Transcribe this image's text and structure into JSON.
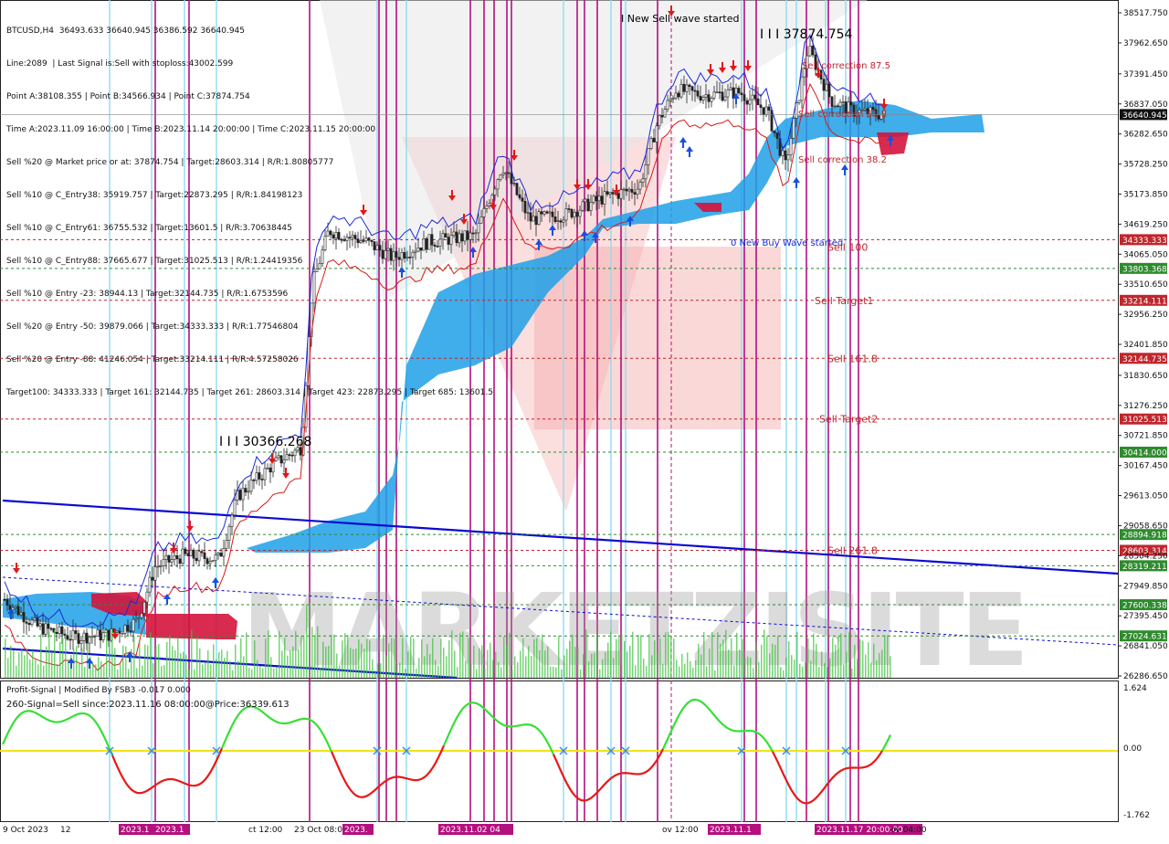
{
  "header": {
    "lines": [
      "BTCUSD,H4  36493.633 36640.945 36386.592 36640.945",
      "Line:2089  | Last Signal is:Sell with stoploss:43002.599",
      "Point A:38108.355 | Point B:34566.934 | Point C:37874.754",
      "Time A:2023.11.09 16:00:00 | Time B:2023.11.14 20:00:00 | Time C:2023.11.15 20:00:00",
      "Sell %20 @ Market price or at: 37874.754 | Target:28603.314 | R/R:1.80805777",
      "Sell %10 @ C_Entry38: 35919.757 | Target:22873.295 | R/R:1.84198123",
      "Sell %10 @ C_Entry61: 36755.532 | Target:13601.5 | R/R:3.70638445",
      "Sell %10 @ C_Entry88: 37665.677 | Target:31025.513 | R/R:1.24419356",
      "Sell %10 @ Entry -23: 38944.13 | Target:32144.735 | R/R:1.6753596",
      "Sell %20 @ Entry -50: 39879.066 | Target:34333.333 | R/R:1.77546804",
      "Sell %20 @ Entry -88: 41246.054 | Target:33214.111 | R/R:4.57258026",
      "Target100: 34333.333 | Target 161: 32144.735 | Target 261: 28603.314 | Target 423: 22873.295 | Target 685: 13601.5"
    ]
  },
  "price_axis": {
    "ticks": [
      "38517.750",
      "37962.650",
      "37391.450",
      "36837.050",
      "36282.650",
      "35728.250",
      "35173.850",
      "34619.250",
      "34065.050",
      "33510.650",
      "32956.250",
      "32401.850",
      "31830.650",
      "31276.250",
      "30721.850",
      "30167.450",
      "29613.050",
      "29058.650",
      "28504.250",
      "27949.850",
      "27395.450",
      "26841.050",
      "26286.650"
    ],
    "current": "36640.945"
  },
  "levels": [
    {
      "value": "34333.333",
      "color": "#c0262c",
      "label": "Sell 100",
      "label_color": "#c0262c"
    },
    {
      "value": "33803.368",
      "color": "#2e8b2e",
      "label": "",
      "label_color": ""
    },
    {
      "value": "33214.111",
      "color": "#c0262c",
      "label": "Sell Target1",
      "label_color": "#c0262c"
    },
    {
      "value": "32144.735",
      "color": "#c0262c",
      "label": "Sell 161.8",
      "label_color": "#c0262c"
    },
    {
      "value": "31025.513",
      "color": "#c0262c",
      "label": "Sell Target2",
      "label_color": "#c0262c"
    },
    {
      "value": "30414.000",
      "color": "#2e8b2e",
      "label": "",
      "label_color": ""
    },
    {
      "value": "28894.918",
      "color": "#2e8b2e",
      "label": "",
      "label_color": ""
    },
    {
      "value": "28603.314",
      "color": "#c0262c",
      "label": "Sell 261.8",
      "label_color": "#c0262c"
    },
    {
      "value": "28319.211",
      "color": "#2e8b2e",
      "label": "",
      "label_color": ""
    },
    {
      "value": "27600.338",
      "color": "#2e8b2e",
      "label": "",
      "label_color": ""
    },
    {
      "value": "27024.631",
      "color": "#2e8b2e",
      "label": "",
      "label_color": ""
    }
  ],
  "annotations": {
    "new_sell": "New Sell wave started",
    "point_c": "I I I 37874.754",
    "point_prev": "I I I 30366.268",
    "new_buy": "0 New Buy Wave started",
    "corr_875": "Sell correction 87.5",
    "corr_618": "Sell correction 61.8",
    "corr_382": "Sell correction 38.2"
  },
  "watermark": "MARKETZISITE",
  "indicator": {
    "title": "Profit-Signal | Modified By FSB3 -0.017 0.000",
    "signal": "260-Signal=Sell since:2023.11.16 08:00:00@Price:36339.613",
    "ticks": [
      "1.624",
      "0.00",
      "-1.762"
    ]
  },
  "time_axis": {
    "labels": [
      "9 Oct 2023",
      "12",
      "2023.1",
      "2023.1",
      "ct 12:00",
      "23 Oct 08:00",
      "2023.",
      "2023.11.02 04",
      "ov 12:00",
      "2023.11.1",
      "2023.11.17 20:00:00",
      "ov 04:00"
    ]
  },
  "colors": {
    "bull": "#2ea02e",
    "bear": "#e03030",
    "cloud_blue": "#1ea0e8",
    "cloud_red": "#d4143c",
    "magenta": "#b4107e",
    "cyan": "#8fdcf0",
    "trend": "#0a0ad2"
  }
}
